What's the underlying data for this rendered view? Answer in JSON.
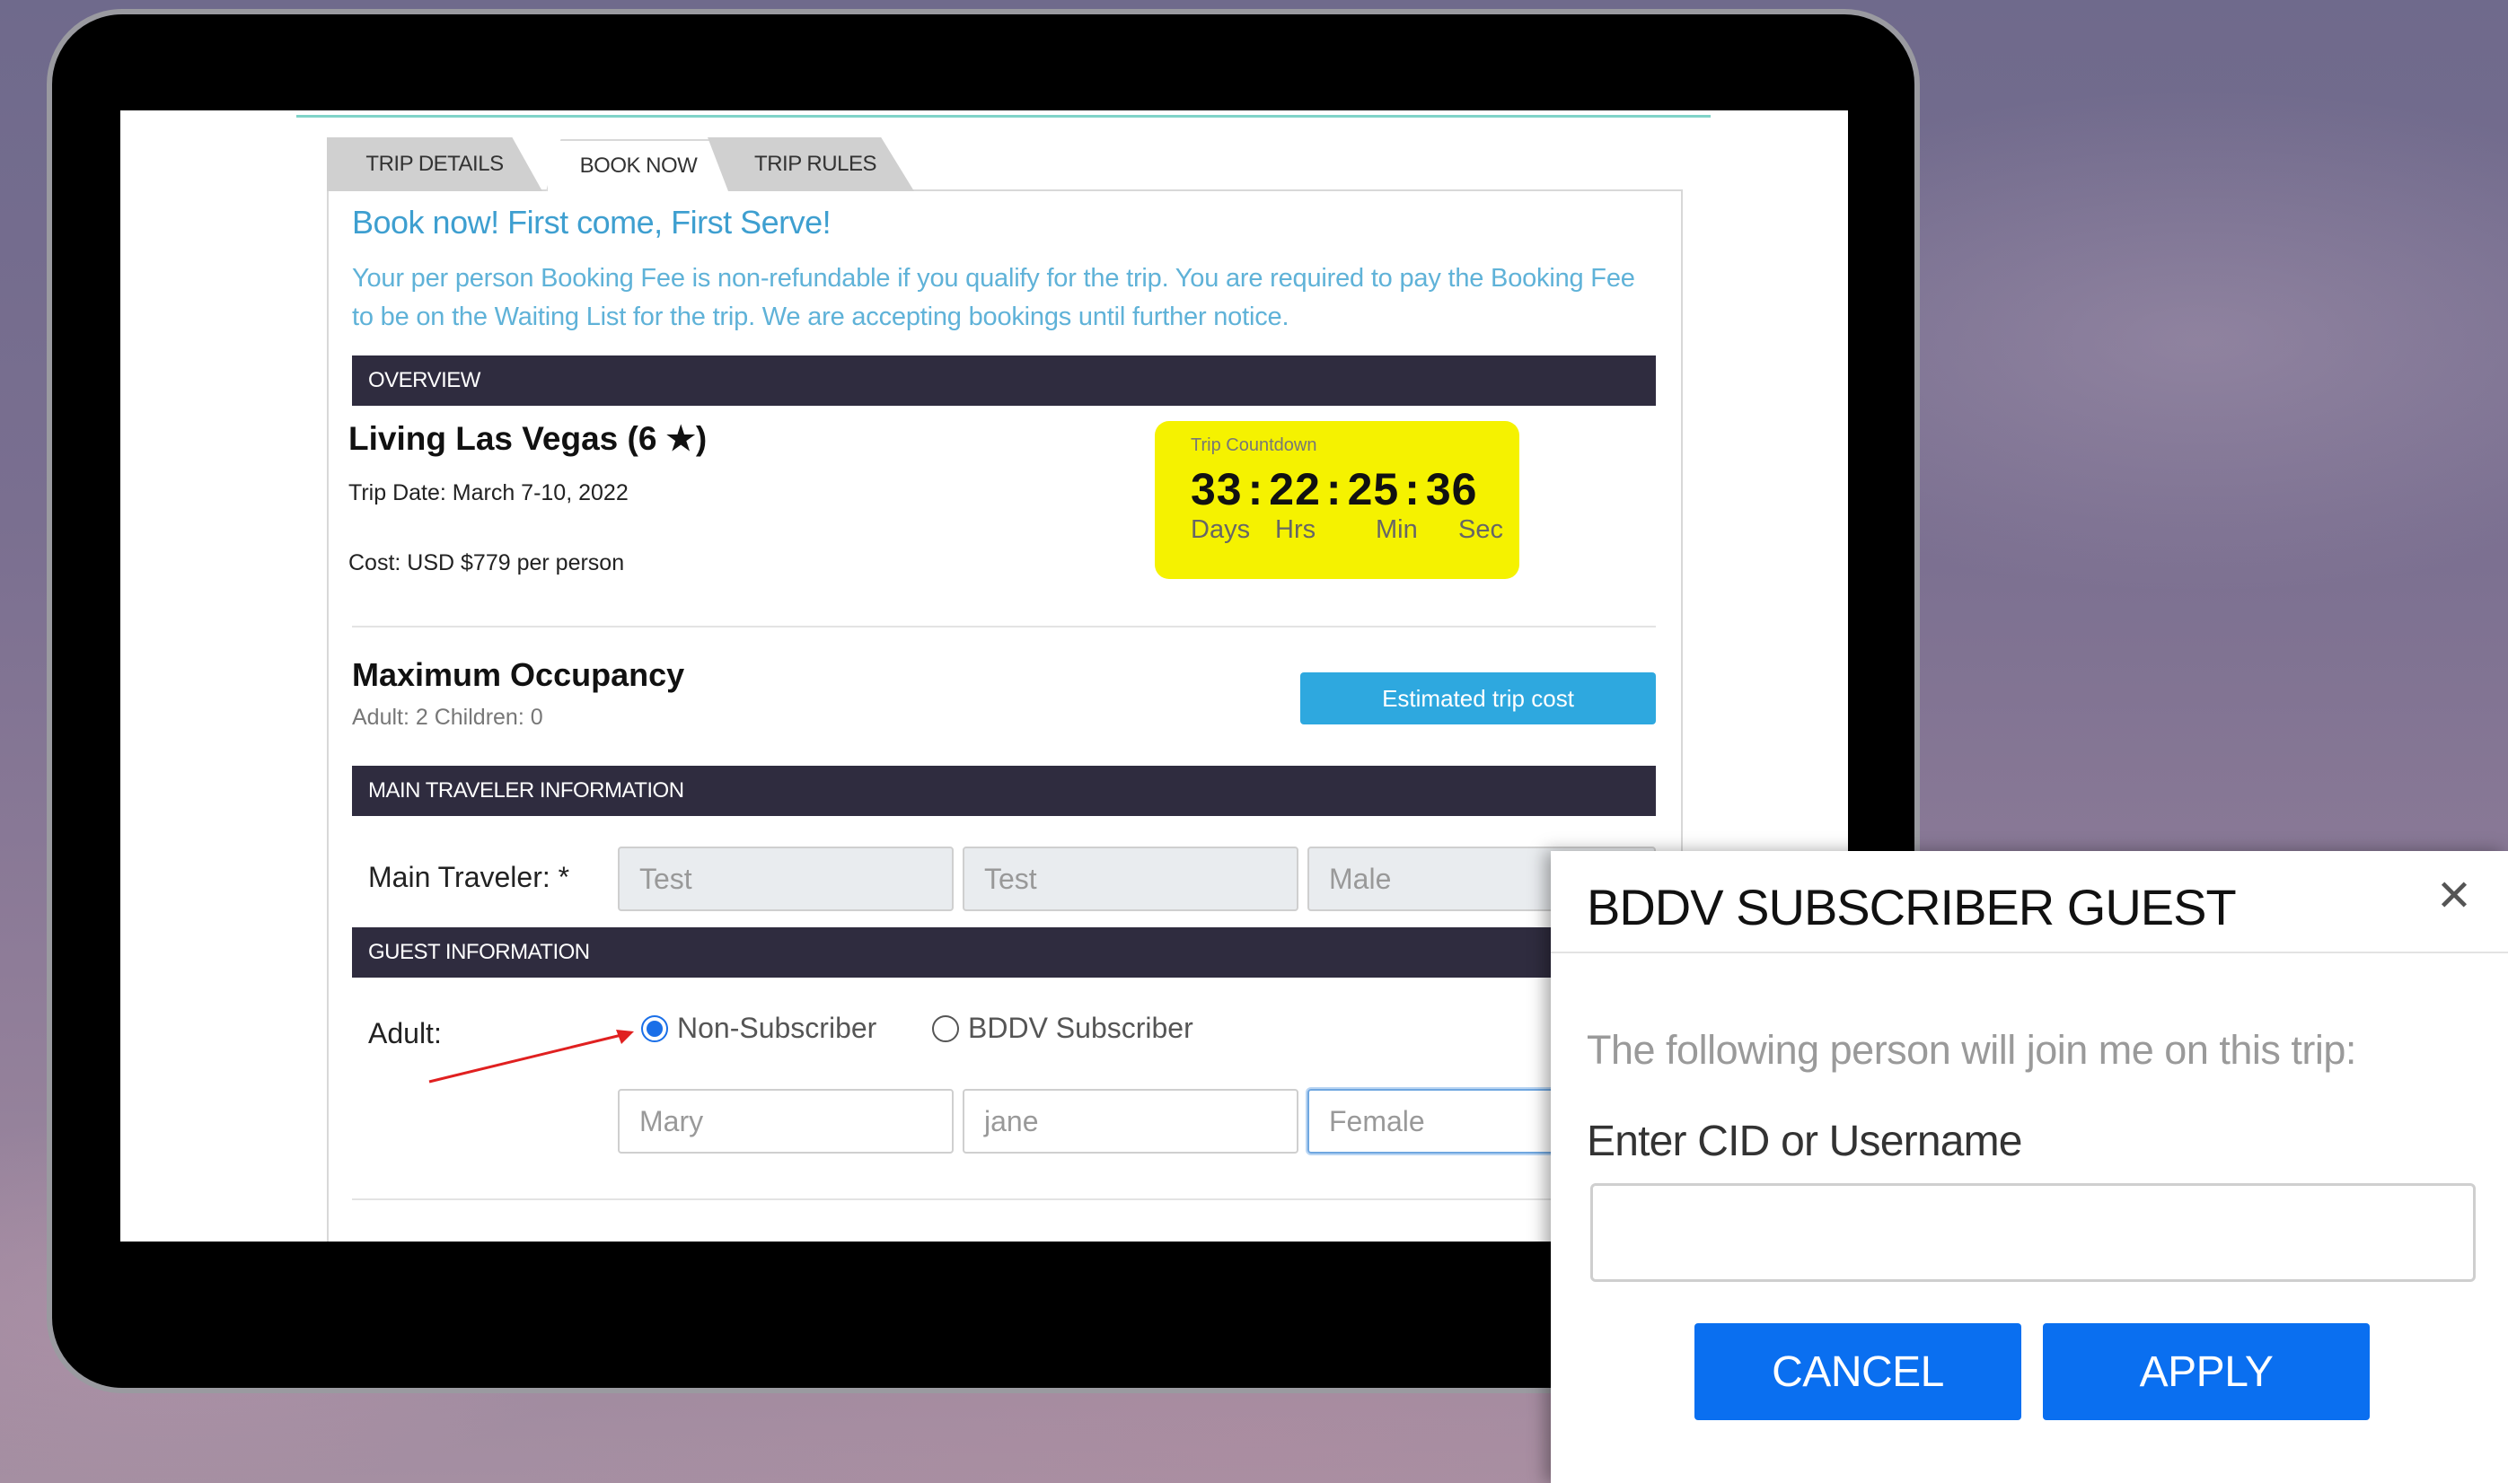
{
  "tabs": [
    {
      "label": "TRIP DETAILS"
    },
    {
      "label": "BOOK NOW"
    },
    {
      "label": "TRIP RULES"
    }
  ],
  "booking": {
    "headline": "Book now! First come, First Serve!",
    "notice": "Your per person Booking Fee is non-refundable if you qualify for the trip. You are required to pay the Booking Fee to be on the Waiting List for the trip. We are accepting bookings until further notice."
  },
  "overview": {
    "section_title": "OVERVIEW",
    "trip_name": "Living Las Vegas (6 ★)",
    "trip_date": "Trip Date: March 7-10, 2022",
    "cost": "Cost: USD $779 per person",
    "countdown": {
      "caption": "Trip Countdown",
      "days": "33",
      "hours": "22",
      "minutes": "25",
      "seconds": "36",
      "labels": {
        "days": "Days",
        "hours": "Hrs",
        "minutes": "Min",
        "seconds": "Sec"
      }
    }
  },
  "occupancy": {
    "title": "Maximum Occupancy",
    "detail": "Adult: 2  Children: 0",
    "estimate_button": "Estimated trip cost"
  },
  "main_traveler": {
    "section_title": "MAIN TRAVELER INFORMATION",
    "label": "Main Traveler: *",
    "first_name": "Test",
    "last_name": "Test",
    "gender": "Male"
  },
  "guest": {
    "section_title": "GUEST INFORMATION",
    "label": "Adult:",
    "option_non_subscriber": "Non-Subscriber",
    "option_subscriber": "BDDV Subscriber",
    "first_name": "Mary",
    "last_name": "jane",
    "gender": "Female"
  },
  "modal": {
    "title": "BDDV SUBSCRIBER GUEST",
    "close": "✕",
    "text": "The following person will join me on this trip:",
    "input_label": "Enter CID or Username",
    "input_value": "",
    "cancel_label": "CANCEL",
    "apply_label": "APPLY"
  },
  "colors": {
    "accent_blue": "#2ea8df",
    "dark_bar": "#2f2c3f",
    "countdown_yellow": "#f5f200",
    "modal_button": "#0a6ff0",
    "annotation_arrow": "#e02020"
  }
}
